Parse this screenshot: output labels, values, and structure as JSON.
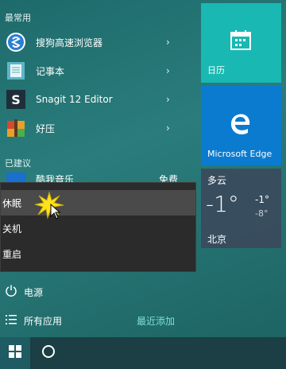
{
  "start_menu": {
    "most_used_label": "最常用",
    "apps": [
      {
        "label": "搜狗高速浏览器",
        "icon": "sogou-browser-icon"
      },
      {
        "label": "记事本",
        "icon": "notepad-icon"
      },
      {
        "label": "Snagit 12 Editor",
        "icon": "snagit-icon"
      },
      {
        "label": "好压",
        "icon": "haozip-icon"
      }
    ],
    "suggested_label": "已建议",
    "suggested_item": {
      "label": "酷我音乐",
      "tag": "免费"
    },
    "power_label": "电源",
    "all_apps_label": "所有应用",
    "recently_added_label": "最近添加"
  },
  "power_menu": {
    "items": [
      {
        "label": "休眠"
      },
      {
        "label": "关机"
      },
      {
        "label": "重启"
      }
    ]
  },
  "tiles": {
    "calendar": {
      "label": "日历"
    },
    "edge": {
      "label": "Microsoft Edge"
    },
    "weather": {
      "condition": "多云",
      "temp": "-1°",
      "high": "-1°",
      "low": "-8°",
      "city": "北京"
    }
  },
  "colors": {
    "calendar_tile": "#19b8b2",
    "edge_tile": "#0b7bd0",
    "accent_text": "#7fe0d6"
  }
}
